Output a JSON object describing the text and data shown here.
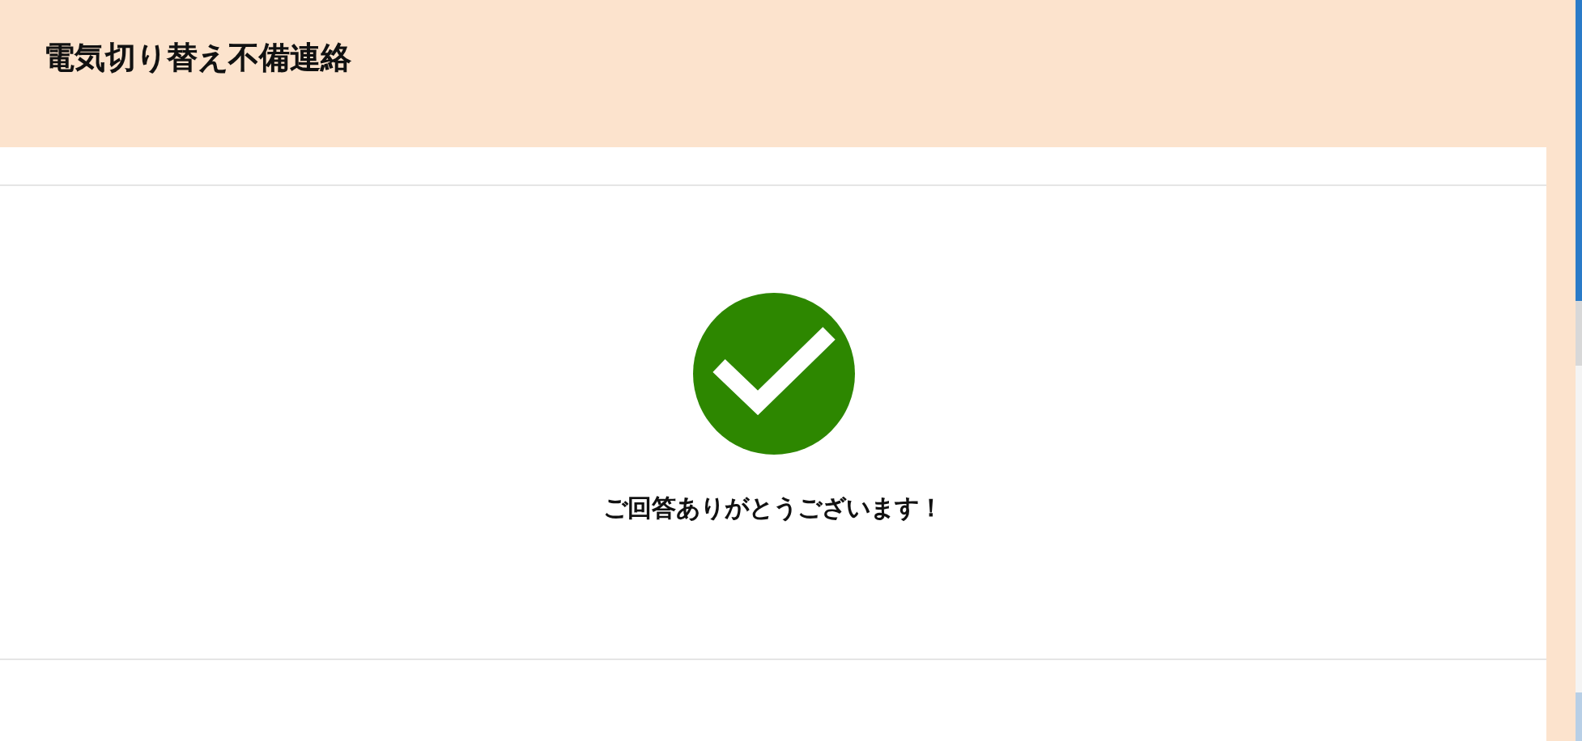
{
  "header": {
    "title": "電気切り替え不備連絡"
  },
  "confirmation": {
    "message": "ご回答ありがとうございます！"
  }
}
